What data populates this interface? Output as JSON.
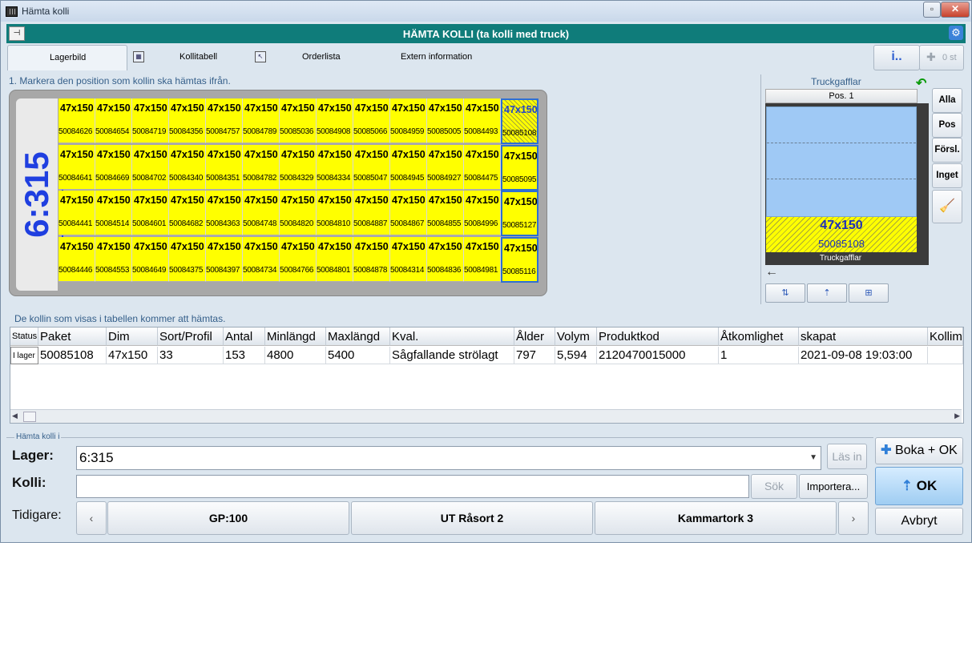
{
  "window": {
    "title": "Hämta kolli"
  },
  "header": {
    "title": "HÄMTA KOLLI (ta kolli med truck)"
  },
  "tabs": [
    {
      "label": "Lagerbild"
    },
    {
      "label": "Kollitabell"
    },
    {
      "label": "Orderlista"
    },
    {
      "label": "Extern information"
    }
  ],
  "topbar": {
    "info_label": "i..",
    "count_label": "0 st"
  },
  "storage": {
    "instruction": "1. Markera den position som kollin ska hämtas ifrån.",
    "location": "6:315",
    "rows": [
      [
        {
          "dim": "47x150",
          "paket": "50084626"
        },
        {
          "dim": "47x150",
          "paket": "50084654"
        },
        {
          "dim": "47x150",
          "paket": "50084719"
        },
        {
          "dim": "47x150",
          "paket": "50084356"
        },
        {
          "dim": "47x150",
          "paket": "50084757"
        },
        {
          "dim": "47x150",
          "paket": "50084789"
        },
        {
          "dim": "47x150",
          "paket": "50085036"
        },
        {
          "dim": "47x150",
          "paket": "50084908"
        },
        {
          "dim": "47x150",
          "paket": "50085066"
        },
        {
          "dim": "47x150",
          "paket": "50084959"
        },
        {
          "dim": "47x150",
          "paket": "50085005"
        },
        {
          "dim": "47x150",
          "paket": "50084493"
        },
        {
          "dim": "47x150",
          "paket": "50085108"
        }
      ],
      [
        {
          "dim": "47x150",
          "paket": "50084641"
        },
        {
          "dim": "47x150",
          "paket": "50084669"
        },
        {
          "dim": "47x150",
          "paket": "50084702"
        },
        {
          "dim": "47x150",
          "paket": "50084340"
        },
        {
          "dim": "47x150",
          "paket": "50084351"
        },
        {
          "dim": "47x150",
          "paket": "50084782"
        },
        {
          "dim": "47x150",
          "paket": "50084329"
        },
        {
          "dim": "47x150",
          "paket": "50084334"
        },
        {
          "dim": "47x150",
          "paket": "50085047"
        },
        {
          "dim": "47x150",
          "paket": "50084945"
        },
        {
          "dim": "47x150",
          "paket": "50084927"
        },
        {
          "dim": "47x150",
          "paket": "50084475"
        },
        {
          "dim": "47x150",
          "paket": "50085095"
        }
      ],
      [
        {
          "dim": "47x150",
          "paket": "50084441"
        },
        {
          "dim": "47x150",
          "paket": "50084514"
        },
        {
          "dim": "47x150",
          "paket": "50084601"
        },
        {
          "dim": "47x150",
          "paket": "50084682"
        },
        {
          "dim": "47x150",
          "paket": "50084363"
        },
        {
          "dim": "47x150",
          "paket": "50084748"
        },
        {
          "dim": "47x150",
          "paket": "50084820"
        },
        {
          "dim": "47x150",
          "paket": "50084810"
        },
        {
          "dim": "47x150",
          "paket": "50084887"
        },
        {
          "dim": "47x150",
          "paket": "50084867"
        },
        {
          "dim": "47x150",
          "paket": "50084855"
        },
        {
          "dim": "47x150",
          "paket": "50084996"
        },
        {
          "dim": "47x150",
          "paket": "50085127"
        }
      ],
      [
        {
          "dim": "47x150",
          "paket": "50084446"
        },
        {
          "dim": "47x150",
          "paket": "50084553"
        },
        {
          "dim": "47x150",
          "paket": "50084649"
        },
        {
          "dim": "47x150",
          "paket": "50084375"
        },
        {
          "dim": "47x150",
          "paket": "50084397"
        },
        {
          "dim": "47x150",
          "paket": "50084734"
        },
        {
          "dim": "47x150",
          "paket": "50084766"
        },
        {
          "dim": "47x150",
          "paket": "50084801"
        },
        {
          "dim": "47x150",
          "paket": "50084878"
        },
        {
          "dim": "47x150",
          "paket": "50084314"
        },
        {
          "dim": "47x150",
          "paket": "50084836"
        },
        {
          "dim": "47x150",
          "paket": "50084981"
        },
        {
          "dim": "47x150",
          "paket": "50085116"
        }
      ]
    ]
  },
  "truck": {
    "title": "Truckgafflar",
    "position": "Pos. 1",
    "loaded_dim": "47x150",
    "loaded_paket": "50085108",
    "fork_label": "Truckgafflar"
  },
  "side_buttons": [
    "Alla",
    "Pos",
    "Försl.",
    "Inget"
  ],
  "table": {
    "instruction": "De kollin som visas i tabellen kommer att hämtas.",
    "columns": [
      "Status",
      "Paket",
      "Dim",
      "Sort/Profil",
      "Antal",
      "Minlängd",
      "Maxlängd",
      "Kval.",
      "Ålder",
      "Volym",
      "Produktkod",
      "Åtkomlighet",
      "skapat",
      "Kollim"
    ],
    "rows": [
      [
        "I lager",
        "50085108",
        "47x150",
        "33",
        "153",
        "4800",
        "5400",
        "Sågfallande strölagt",
        "797",
        "5,594",
        "2120470015000",
        "1",
        "2021-09-08 19:03:00",
        ""
      ]
    ]
  },
  "form": {
    "group_label": "Hämta kolli i",
    "lager_label": "Lager:",
    "lager_value": "6:315",
    "kolli_label": "Kolli:",
    "kolli_value": "",
    "tidigare_label": "Tidigare:",
    "las_in": "Läs in",
    "sok": "Sök",
    "importera": "Importera...",
    "history": [
      "GP:100",
      "UT Råsort 2",
      "Kammartork 3"
    ]
  },
  "actions": {
    "boka_ok": "Boka + OK",
    "ok": "OK",
    "avbryt": "Avbryt"
  },
  "colors": {
    "header": "#0f7c7a",
    "cell": "#ffff00",
    "accent": "#1f3fe0",
    "slot": "#9fc9f5"
  }
}
